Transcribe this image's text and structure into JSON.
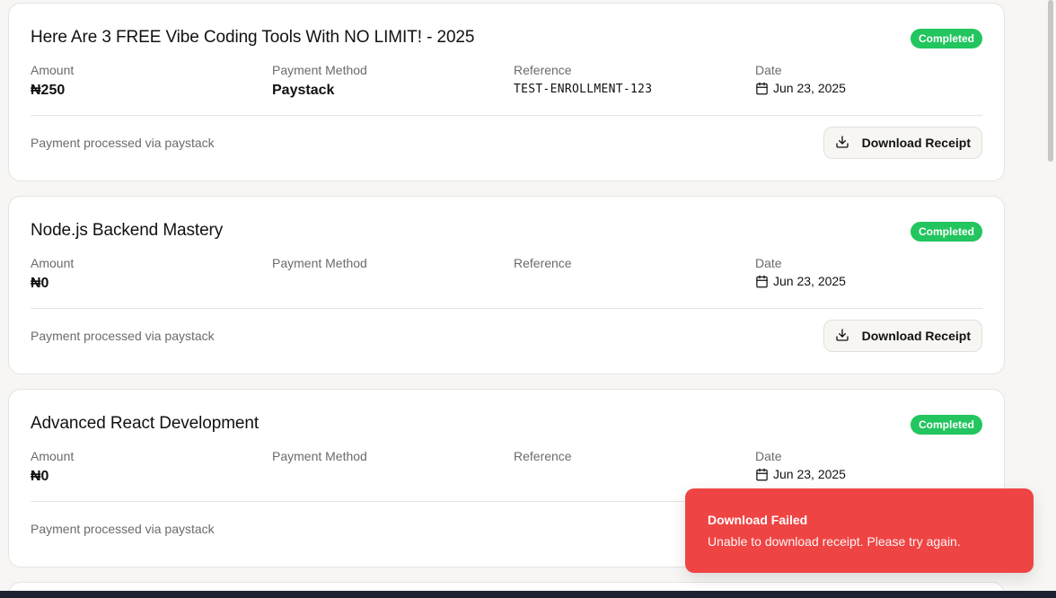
{
  "labels": {
    "amount": "Amount",
    "payment_method": "Payment Method",
    "reference": "Reference",
    "date": "Date",
    "download_receipt": "Download Receipt"
  },
  "cards": [
    {
      "title": "Here Are 3 FREE Vibe Coding Tools With NO LIMIT! - 2025",
      "status": "Completed",
      "amount": "₦250",
      "payment_method": "Paystack",
      "reference": "TEST-ENROLLMENT-123",
      "date": "Jun 23, 2025",
      "note": "Payment processed via paystack"
    },
    {
      "title": "Node.js Backend Mastery",
      "status": "Completed",
      "amount": "₦0",
      "payment_method": "",
      "reference": "",
      "date": "Jun 23, 2025",
      "note": "Payment processed via paystack"
    },
    {
      "title": "Advanced React Development",
      "status": "Completed",
      "amount": "₦0",
      "payment_method": "",
      "reference": "",
      "date": "Jun 23, 2025",
      "note": "Payment processed via paystack"
    }
  ],
  "toast": {
    "title": "Download Failed",
    "message": "Unable to download receipt. Please try again."
  },
  "colors": {
    "status_completed": "#22c55e",
    "toast_error": "#ef4444"
  },
  "icons": {
    "date": "calendar-icon",
    "download": "download-icon"
  }
}
